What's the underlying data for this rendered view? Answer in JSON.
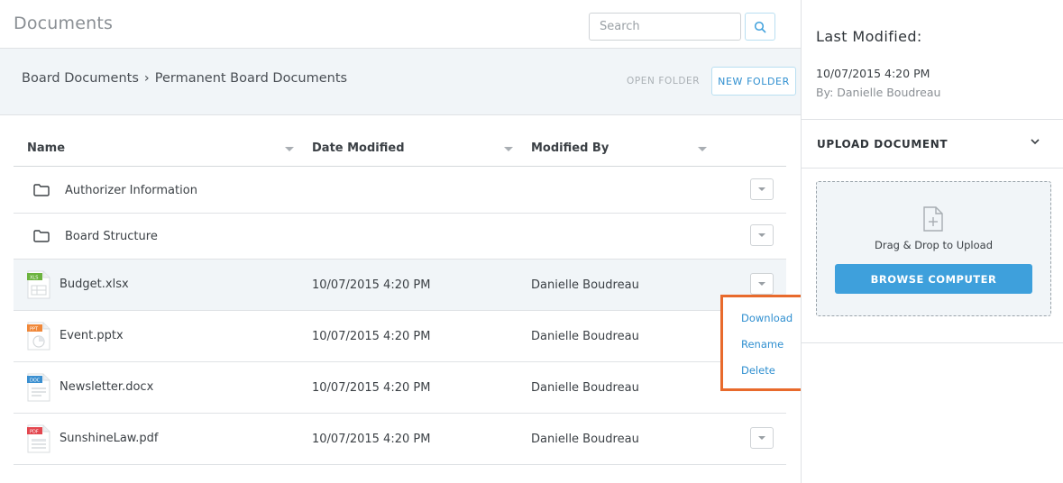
{
  "header": {
    "title": "Documents",
    "search_placeholder": "Search"
  },
  "toolbar": {
    "breadcrumb": [
      "Board Documents",
      "›",
      "Permanent Board Documents"
    ],
    "open_folder_label": "OPEN FOLDER",
    "new_folder_label": "NEW FOLDER"
  },
  "table": {
    "columns": [
      "Name",
      "Date Modified",
      "Modified By"
    ],
    "rows": [
      {
        "type": "folder",
        "name": "Authorizer Information",
        "date": "",
        "by": ""
      },
      {
        "type": "folder",
        "name": "Board Structure",
        "date": "",
        "by": ""
      },
      {
        "type": "xlsx",
        "badge": "XLS",
        "color": "#6cb33f",
        "name": "Budget.xlsx",
        "date": "10/07/2015 4:20 PM",
        "by": "Danielle Boudreau"
      },
      {
        "type": "pptx",
        "badge": "PPT",
        "color": "#f0883a",
        "name": "Event.pptx",
        "date": "10/07/2015 4:20 PM",
        "by": "Danielle Boudreau"
      },
      {
        "type": "docx",
        "badge": "DOC",
        "color": "#3a8fd0",
        "name": "Newsletter.docx",
        "date": "10/07/2015 4:20 PM",
        "by": "Danielle Boudreau"
      },
      {
        "type": "pdf",
        "badge": "PDF",
        "color": "#e3474f",
        "name": "SunshineLaw.pdf",
        "date": "10/07/2015 4:20 PM",
        "by": "Danielle Boudreau"
      }
    ]
  },
  "row_menu": {
    "items": [
      "Download",
      "Rename",
      "Delete"
    ],
    "highlight_color": "#e86a2c"
  },
  "sidebar": {
    "last_modified_title": "Last Modified:",
    "last_modified_date": "10/07/2015 4:20 PM",
    "last_modified_by": "By: Danielle Boudreau",
    "upload_title": "UPLOAD DOCUMENT",
    "dropzone_text": "Drag & Drop to Upload",
    "browse_label": "BROWSE COMPUTER"
  },
  "colors": {
    "accent": "#3ea0dc",
    "link": "#2f8fd0"
  }
}
